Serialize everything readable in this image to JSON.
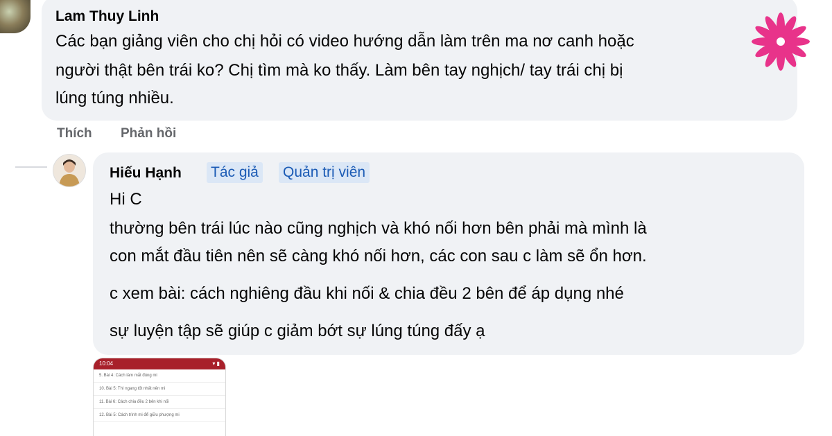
{
  "comment": {
    "author": "Lam Thuy Linh",
    "lines": [
      "Các bạn giảng viên cho chị hỏi có video hướng dẫn làm trên ma nơ canh hoặc",
      "người thật bên trái ko? Chị tìm mà ko thấy. Làm bên tay nghịch/ tay trái chị bị",
      "lúng túng nhiều."
    ],
    "actions": {
      "like": "Thích",
      "reply": "Phản hồi"
    }
  },
  "reply": {
    "author": "Hiếu Hạnh",
    "badges": [
      "Tác giả",
      "Quản trị viên"
    ],
    "lines": [
      "Hi C",
      "thường bên trái lúc nào cũng nghịch và khó nối hơn bên phải mà mình là",
      "con mắt đầu tiên nên sẽ càng khó nối hơn, các con sau c làm sẽ ổn hơn.",
      "c xem bài: cách nghiêng đầu khi nối & chia đều 2 bên để áp dụng nhé",
      "sự luyện tập sẽ giúp c giảm bớt sự lúng túng đấy ạ"
    ]
  },
  "attachment": {
    "status_time": "10:04",
    "rows": [
      "5. Bài 4: Cách làm mắt đúng mi",
      "10. Bài 5: Thì ngang tốt nhất nên mi",
      "11. Bài 6: Cách chia đều 2 bên khi nối",
      "12. Bài 5: Cách trình mi để giữu phượng mi"
    ]
  },
  "colors": {
    "bubble": "#f0f2f5",
    "badge_bg": "#dbe7f6",
    "badge_text": "#1b5bb5",
    "action_text": "#65676b",
    "logo": "#e8338a"
  },
  "icons": {
    "logo": "lotus-logo-icon"
  }
}
